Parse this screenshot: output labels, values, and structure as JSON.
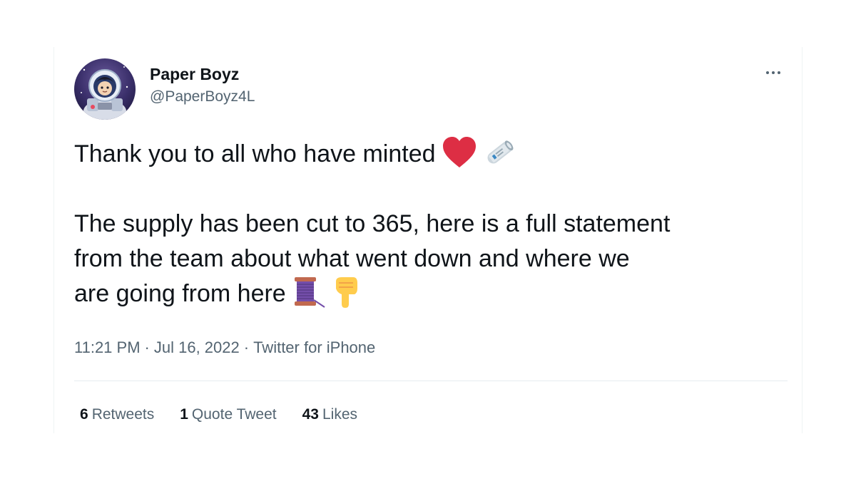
{
  "tweet": {
    "author": {
      "display_name": "Paper Boyz",
      "handle": "@PaperBoyz4L",
      "avatar_icon": "astronaut-avatar"
    },
    "more_icon": "more-options-icon",
    "text_lines": [
      "Thank you to all who have minted",
      "",
      "The supply has been cut to 365, here is a full statement",
      "from the team about what went down and where we",
      "are going from here"
    ],
    "emojis": {
      "line1": [
        "red-heart-icon",
        "rolled-newspaper-icon"
      ],
      "line5": [
        "thread-spool-icon",
        "pointing-down-icon"
      ]
    },
    "time": "11:21 PM",
    "date": "Jul 16, 2022",
    "source": "Twitter for iPhone",
    "separator": "·",
    "stats": {
      "retweets_count": "6",
      "retweets_label": "Retweets",
      "quotes_count": "1",
      "quotes_label": "Quote Tweet",
      "likes_count": "43",
      "likes_label": "Likes"
    }
  },
  "colors": {
    "text_primary": "#0f1419",
    "text_secondary": "#536471",
    "divider": "#e6ecf0",
    "heart": "#dd2e44",
    "spool": "#744eaa"
  }
}
